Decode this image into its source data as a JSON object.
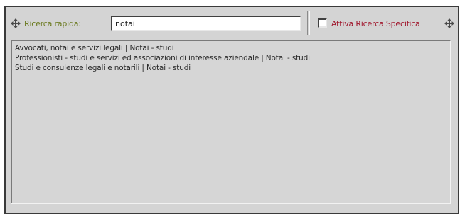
{
  "search": {
    "label": "Ricerca rapida:",
    "value": "notai",
    "left_icon": "four-way-move-arrow-icon",
    "right_icon": "four-way-move-arrow-icon"
  },
  "specific_search": {
    "label": "Attiva Ricerca Specifica",
    "checked": false
  },
  "results": [
    "Avvocati, notai e servizi legali | Notai - studi",
    "Professionisti - studi e servizi ed associazioni di interesse aziendale | Notai - studi",
    "Studi e consulenze legali e notarili | Notai - studi"
  ],
  "colors": {
    "panel_bg": "#d4d4d4",
    "label_green": "#6b7a1f",
    "label_red": "#a0162c"
  }
}
